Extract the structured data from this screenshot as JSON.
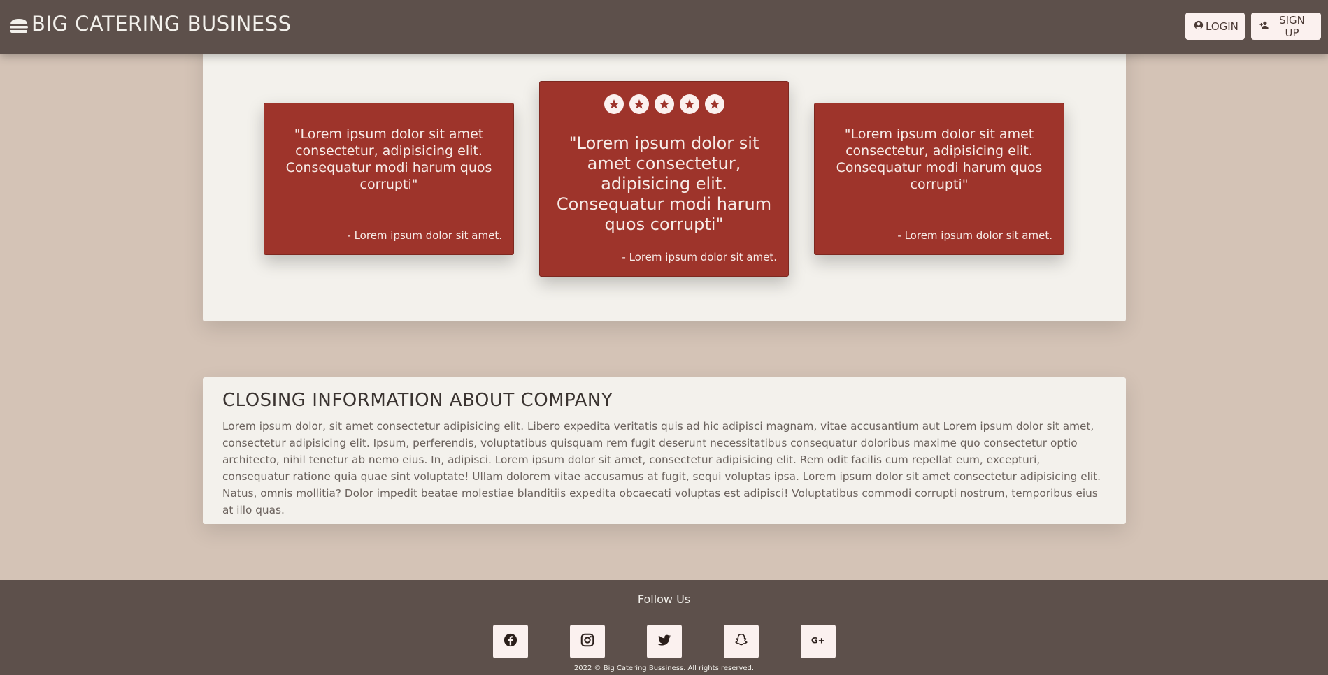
{
  "header": {
    "brand_icon": "burger-icon",
    "brand_title": "BIG CATERING BUSINESS",
    "login_label": "LOGIN",
    "login_icon": "user-circle-icon",
    "signup_label": "SIGN UP",
    "signup_icon": "user-plus-icon"
  },
  "testimonials": {
    "rating": {
      "value": 5,
      "max": 5,
      "icon": "star-icon"
    },
    "cards": [
      {
        "quote": "\"Lorem ipsum dolor sit amet consectetur, adipisicing elit. Consequatur modi harum quos corrupti\"",
        "author": "- Lorem ipsum dolor sit amet."
      },
      {
        "quote": "\"Lorem ipsum dolor sit amet consectetur, adipisicing elit. Consequatur modi harum quos corrupti\"",
        "author": "- Lorem ipsum dolor sit amet."
      },
      {
        "quote": "\"Lorem ipsum dolor sit amet consectetur, adipisicing elit. Consequatur modi harum quos corrupti\"",
        "author": "- Lorem ipsum dolor sit amet."
      }
    ]
  },
  "closing": {
    "title": "CLOSING INFORMATION ABOUT COMPANY",
    "text": "Lorem ipsum dolor, sit amet consectetur adipisicing elit. Libero expedita veritatis quis ad hic adipisci magnam, vitae accusantium aut Lorem ipsum dolor sit amet, consectetur adipisicing elit. Ipsum, perferendis, voluptatibus quisquam rem fugit deserunt necessitatibus consequatur doloribus maxime quo consectetur optio architecto, nihil tenetur ab nemo eius. In, adipisci. Lorem ipsum dolor sit amet, consectetur adipisicing elit. Rem odit facilis cum repellat eum, excepturi, consequatur ratione quia quae sint voluptate! Ullam dolorem vitae accusamus at fugit, sequi voluptas ipsa. Lorem ipsum dolor sit amet consectetur adipisicing elit. Natus, omnis mollitia? Dolor impedit beatae molestiae blanditiis expedita obcaecati voluptas est adipisci! Voluptatibus commodi corrupti nostrum, temporibus eius at illo quas."
  },
  "footer": {
    "follow_label": "Follow Us",
    "social": [
      {
        "name": "facebook-icon"
      },
      {
        "name": "instagram-icon"
      },
      {
        "name": "twitter-icon"
      },
      {
        "name": "snapchat-icon"
      },
      {
        "name": "google-plus-icon"
      }
    ],
    "copyright": "2022 © Big Catering Bussiness. All rights reserved."
  },
  "colors": {
    "header_bg": "#5d504b",
    "page_bg": "#d4c3b6",
    "panel_bg": "#f3f1ec",
    "card_bg": "#9e342b",
    "button_bg": "#fbf1ef"
  }
}
